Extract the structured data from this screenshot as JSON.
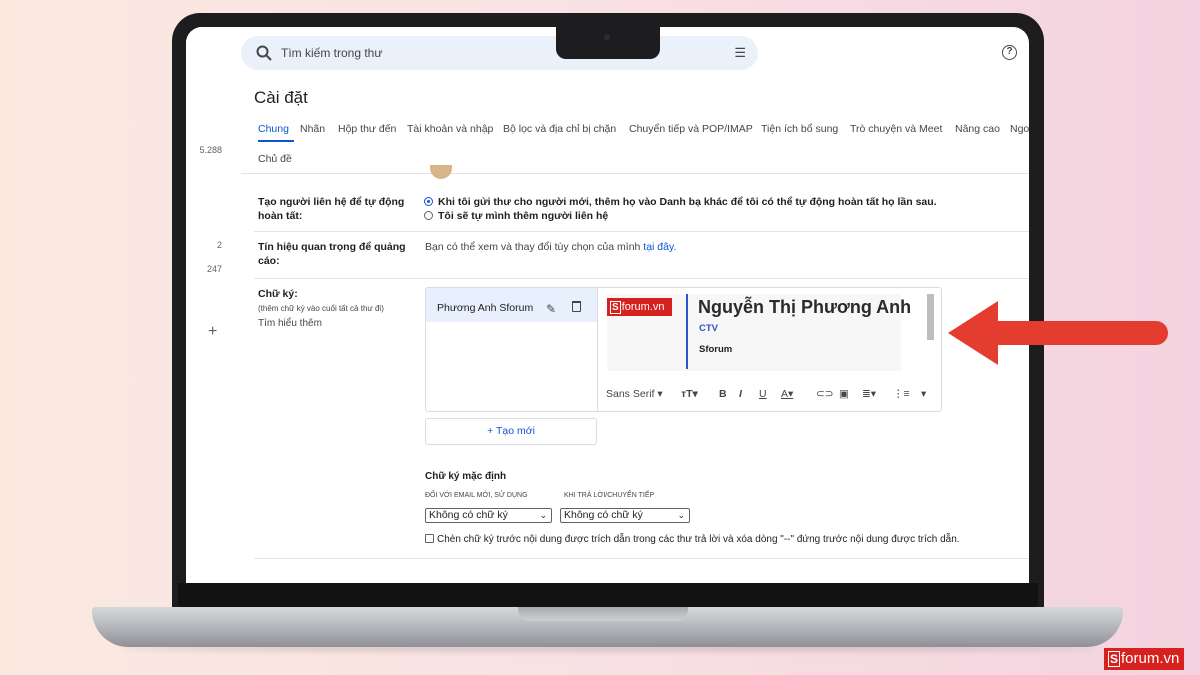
{
  "search": {
    "placeholder": "Tìm kiếm trong thư"
  },
  "rail": {
    "counts": [
      "5.288",
      "2",
      "247"
    ]
  },
  "settings": {
    "title": "Cài đặt",
    "tabs": [
      "Chung",
      "Nhãn",
      "Hộp thư đến",
      "Tài khoản và nhập",
      "Bộ lọc và địa chỉ bị chặn",
      "Chuyển tiếp và POP/IMAP",
      "Tiện ích bổ sung",
      "Trò chuyện và Meet",
      "Nâng cao",
      "Ngo"
    ],
    "tab_row2": "Chủ đề"
  },
  "autocomplete": {
    "label": "Tạo người liên hệ để tự động hoàn tất:",
    "option1": "Khi tôi gửi thư cho người mới, thêm họ vào Danh bạ khác để tôi có thể tự động hoàn tất họ lần sau.",
    "option2": "Tôi sẽ tự mình thêm người liên hệ"
  },
  "ads": {
    "label": "Tín hiệu quan trọng để quảng cáo:",
    "text": "Bạn có thể xem và thay đổi tùy chọn của mình ",
    "link": "tại đây."
  },
  "signature": {
    "label": "Chữ ký:",
    "hint": "(thêm chữ ký vào cuối tất cả thư đi)",
    "learn_more": "Tìm hiểu thêm",
    "item_name": "Phương Anh Sforum",
    "badge_text": "forum.vn",
    "badge_letter": "S",
    "full_name": "Nguyễn Thị Phương Anh",
    "role": "CTV",
    "org": "Sforum",
    "font": "Sans Serif",
    "new_button": "Tạo mới"
  },
  "defaults": {
    "title": "Chữ ký mặc định",
    "new_email_label": "ĐỐI VỚI EMAIL MỚI, SỬ DỤNG",
    "reply_label": "KHI TRẢ LỜI/CHUYỂN TIẾP",
    "new_email_value": "Không có chữ ký",
    "reply_value": "Không có chữ ký",
    "insert_before": "Chèn chữ ký trước nội dung được trích dẫn trong các thư trả lời và xóa dòng \"--\" đứng trước nội dung được trích dẫn."
  },
  "watermark": {
    "letter": "S",
    "text": "forum.vn"
  },
  "colors": {
    "accent": "#0b57d0",
    "arrow": "#e43d30",
    "brand": "#d7211e"
  }
}
